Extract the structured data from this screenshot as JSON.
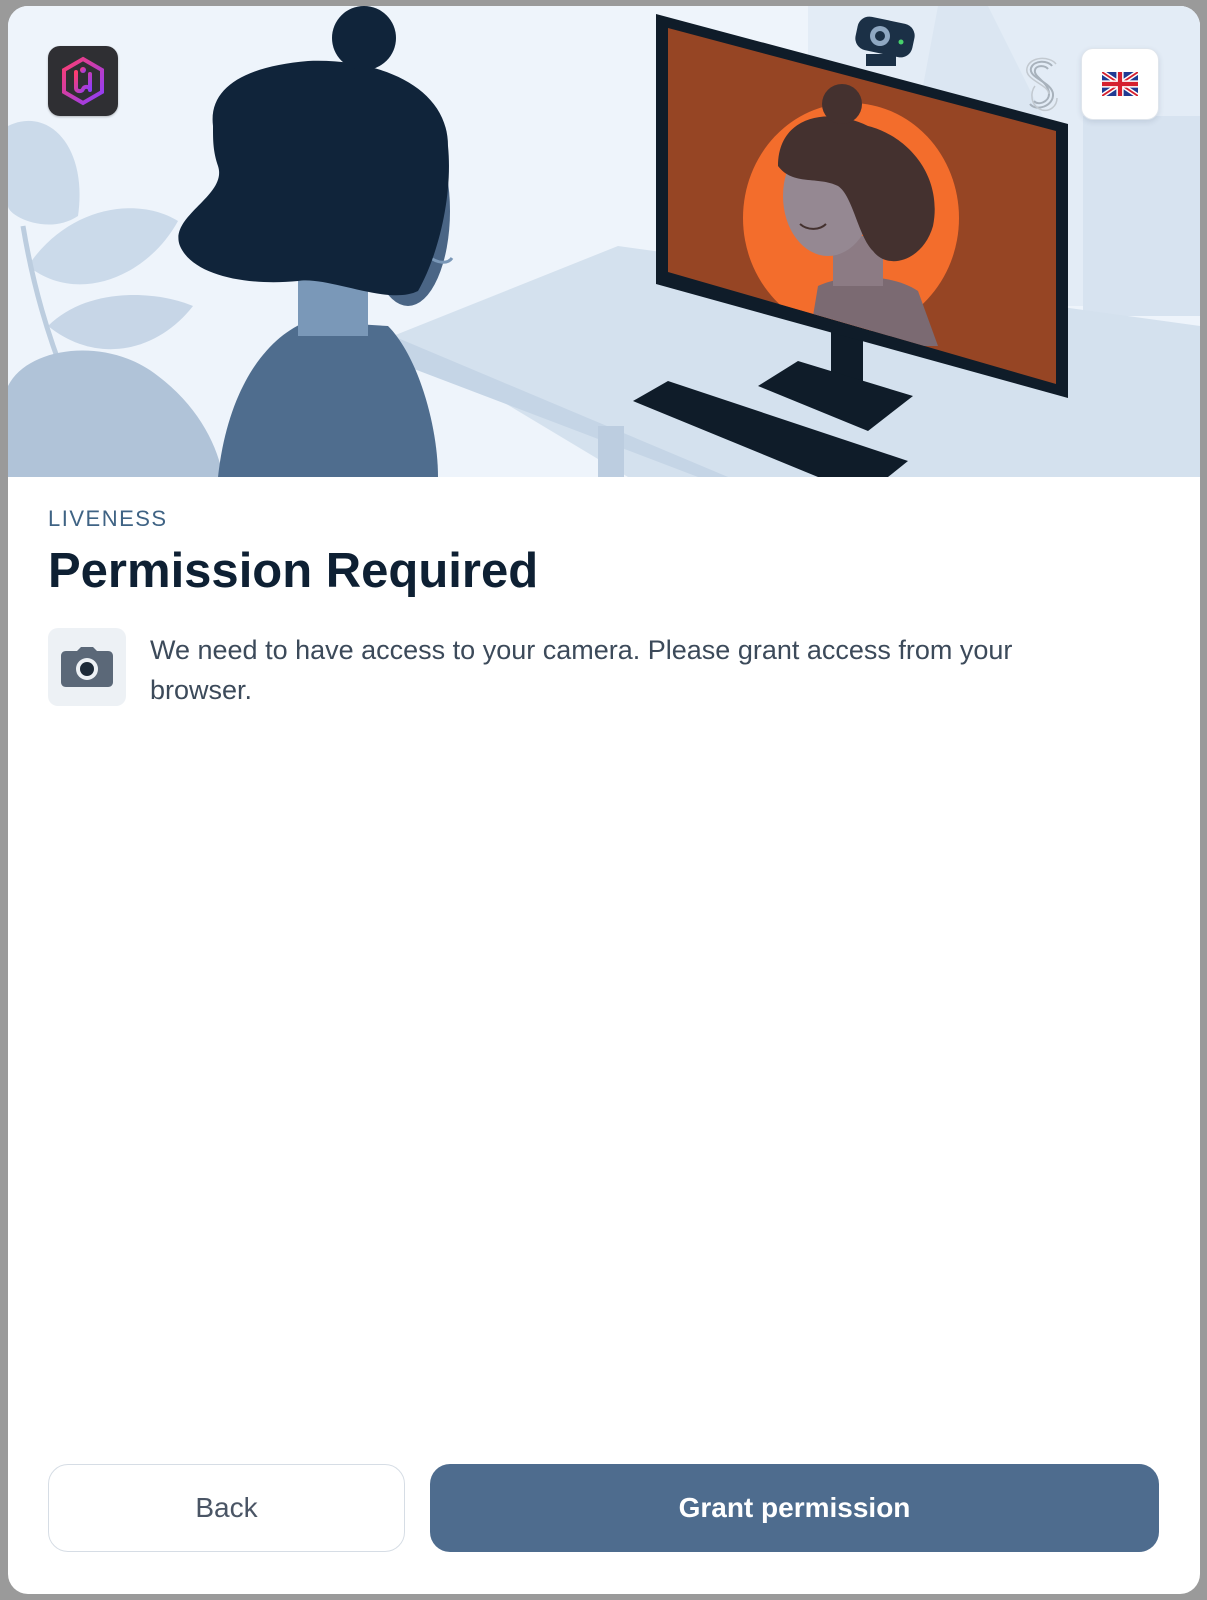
{
  "header": {
    "app_logo_icon": "hexagon-shield-logo-icon",
    "brand_mark_icon": "fingerprint-s-icon",
    "language_flag_icon": "uk-flag-icon"
  },
  "page": {
    "eyebrow": "LIVENESS",
    "title": "Permission Required",
    "info_icon": "camera-icon",
    "info_text": "We need to have access to your camera. Please grant access from your browser."
  },
  "actions": {
    "back_label": "Back",
    "grant_label": "Grant permission"
  },
  "colors": {
    "primary_button": "#4e6c8e",
    "title": "#0e2033",
    "eyebrow": "#3f6384",
    "screen_bg": "#964524",
    "screen_circle": "#f36d2c"
  }
}
